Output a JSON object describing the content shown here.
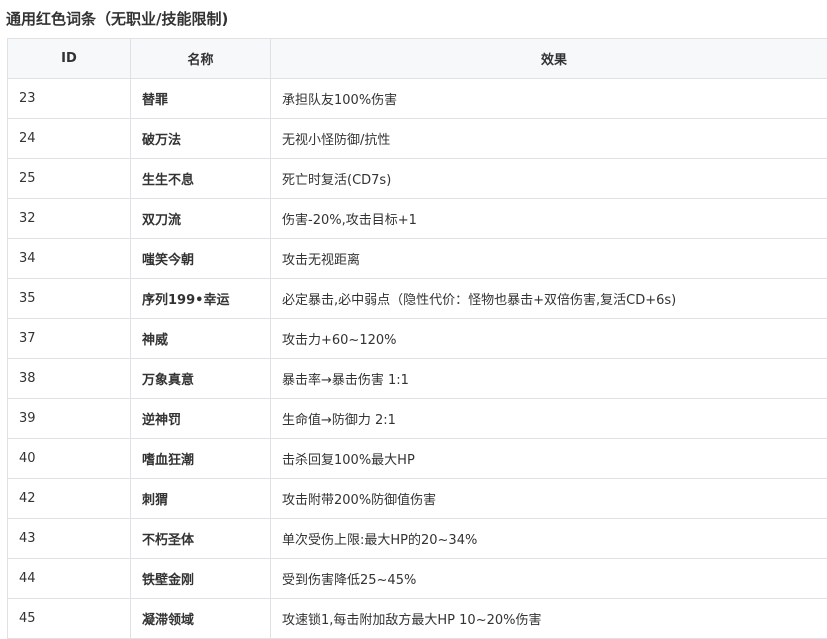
{
  "heading": "通用红色词条（无职业/技能限制)",
  "table": {
    "headers": {
      "id": "ID",
      "name": "名称",
      "effect": "效果"
    },
    "rows": [
      {
        "id": "23",
        "name": "替罪",
        "effect": "承担队友100%伤害"
      },
      {
        "id": "24",
        "name": "破万法",
        "effect": "无视小怪防御/抗性"
      },
      {
        "id": "25",
        "name": "生生不息",
        "effect": "死亡时复活(CD7s)"
      },
      {
        "id": "32",
        "name": "双刀流",
        "effect": "伤害-20%,攻击目标+1"
      },
      {
        "id": "34",
        "name": "嗤笑今朝",
        "effect": "攻击无视距离"
      },
      {
        "id": "35",
        "name": "序列199•幸运",
        "effect": "必定暴击,必中弱点（隐性代价：怪物也暴击+双倍伤害,复活CD+6s)"
      },
      {
        "id": "37",
        "name": "神威",
        "effect": "攻击力+60~120%"
      },
      {
        "id": "38",
        "name": "万象真意",
        "effect": "暴击率→暴击伤害 1:1"
      },
      {
        "id": "39",
        "name": "逆神罚",
        "effect": "生命值→防御力 2:1"
      },
      {
        "id": "40",
        "name": "嗜血狂潮",
        "effect": "击杀回复100%最大HP"
      },
      {
        "id": "42",
        "name": "刺猬",
        "effect": "攻击附带200%防御值伤害"
      },
      {
        "id": "43",
        "name": "不朽圣体",
        "effect": "单次受伤上限:最大HP的20~34%"
      },
      {
        "id": "44",
        "name": "铁壁金刚",
        "effect": "受到伤害降低25~45%"
      },
      {
        "id": "45",
        "name": "凝滞领域",
        "effect": "攻速锁1,每击附加敌方最大HP 10~20%伤害"
      }
    ]
  }
}
